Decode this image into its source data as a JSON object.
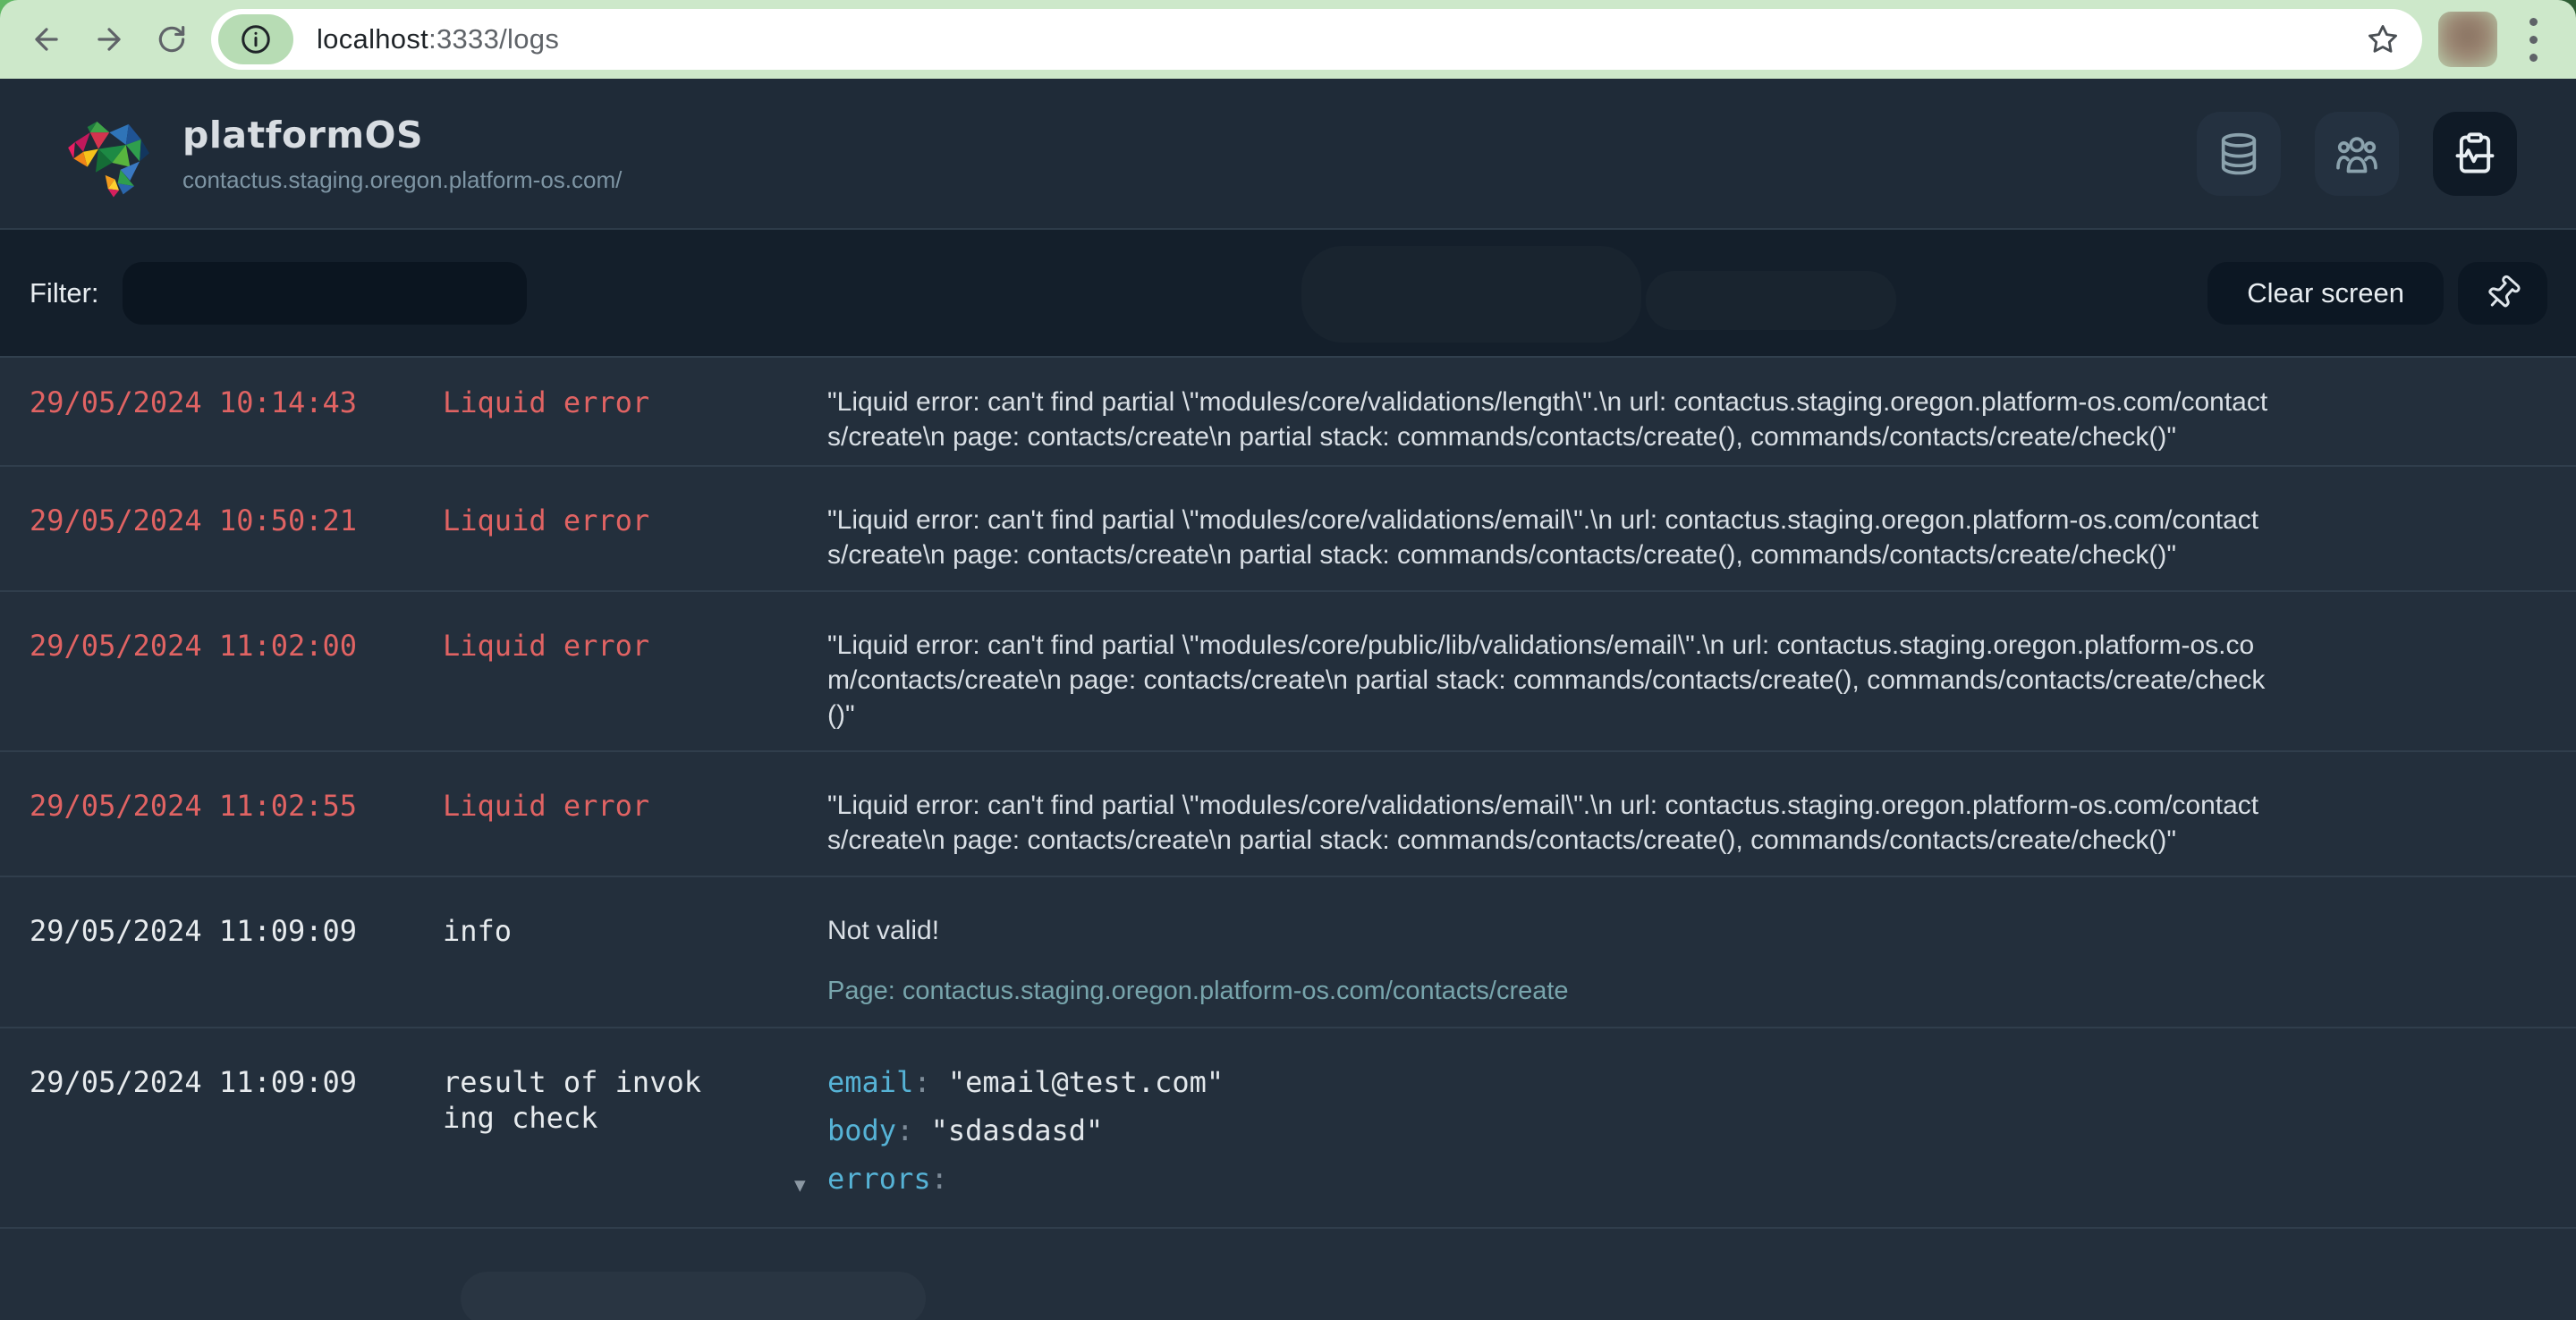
{
  "colors": {
    "chrome_green": "#cde8ca",
    "header_bg": "#1f2b38",
    "rows_bg": "#232f3c",
    "error_red": "#e06363",
    "key_cyan": "#56b3d6",
    "link_teal": "#78a5ac"
  },
  "browser": {
    "url_host": "localhost",
    "url_rest": ":3333/logs"
  },
  "header": {
    "app_name": "platformOS",
    "site_url": "contactus.staging.oregon.platform-os.com/"
  },
  "filterbar": {
    "label": "Filter:",
    "input_value": "",
    "clear_label": "Clear screen"
  },
  "ui": {
    "colon": ":",
    "expander": "▼"
  },
  "logs": [
    {
      "timestamp": "29/05/2024 10:14:43",
      "type": "Liquid error",
      "message": "\"Liquid error: can't find partial \\\"modules/core/validations/length\\\".\\n url: contactus.staging.oregon.platform-os.com/contacts/create\\n page: contacts/create\\n partial stack: commands/contacts/create(), commands/contacts/create/check()\""
    },
    {
      "timestamp": "29/05/2024 10:50:21",
      "type": "Liquid error",
      "message": "\"Liquid error: can't find partial \\\"modules/core/validations/email\\\".\\n url: contactus.staging.oregon.platform-os.com/contacts/create\\n page: contacts/create\\n partial stack: commands/contacts/create(), commands/contacts/create/check()\""
    },
    {
      "timestamp": "29/05/2024 11:02:00",
      "type": "Liquid error",
      "message": "\"Liquid error: can't find partial \\\"modules/core/public/lib/validations/email\\\".\\n url: contactus.staging.oregon.platform-os.com/contacts/create\\n page: contacts/create\\n partial stack: commands/contacts/create(), commands/contacts/create/check()\""
    },
    {
      "timestamp": "29/05/2024 11:02:55",
      "type": "Liquid error",
      "message": "\"Liquid error: can't find partial \\\"modules/core/validations/email\\\".\\n url: contactus.staging.oregon.platform-os.com/contacts/create\\n page: contacts/create\\n partial stack: commands/contacts/create(), commands/contacts/create/check()\""
    },
    {
      "timestamp": "29/05/2024 11:09:09",
      "type": "info",
      "message": "Not valid!",
      "page": "Page: contactus.staging.oregon.platform-os.com/contacts/create"
    },
    {
      "timestamp": "29/05/2024 11:09:09",
      "type": "result of invoking check",
      "entries": [
        {
          "key": "email",
          "value": "\"email@test.com\""
        },
        {
          "key": "body",
          "value": "\"sdasdasd\""
        },
        {
          "key": "errors",
          "value": ""
        }
      ]
    }
  ]
}
